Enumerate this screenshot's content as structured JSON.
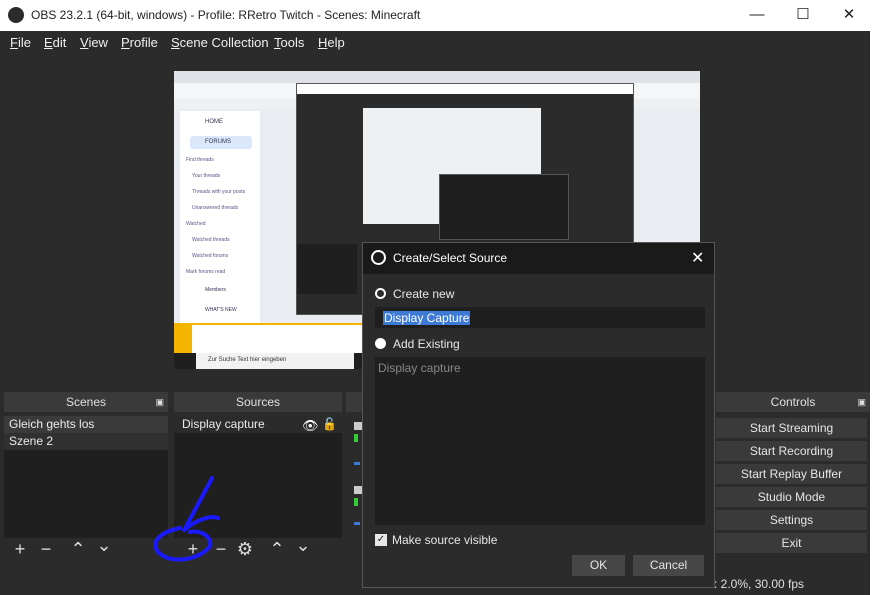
{
  "window": {
    "title": "OBS 23.2.1 (64-bit, windows) - Profile: RRetro Twitch - Scenes: Minecraft",
    "minimize": "—",
    "maximize": "☐",
    "close": "✕"
  },
  "menu": {
    "items": [
      {
        "label": "File",
        "key": "F"
      },
      {
        "label": "Edit",
        "key": "E"
      },
      {
        "label": "View",
        "key": "V"
      },
      {
        "label": "Profile",
        "key": "P"
      },
      {
        "label": "Scene Collection",
        "key": "S"
      },
      {
        "label": "Tools",
        "key": "T"
      },
      {
        "label": "Help",
        "key": "H"
      }
    ]
  },
  "preview": {
    "sidebar": [
      "HOME",
      "FORUMS"
    ],
    "links": [
      "Find threads",
      "Your threads",
      "Threads with your posts",
      "Unanswered threads",
      "Watched",
      "Watched threads",
      "Watched forums",
      "Mark forums read",
      "Members",
      "WHAT'S NEW"
    ],
    "search_hint": "Zur Suche Text hier eingeben"
  },
  "scenes": {
    "title": "Scenes",
    "items": [
      "Gleich gehts los",
      "Szene 2"
    ]
  },
  "sources": {
    "title": "Sources",
    "items": [
      "Display capture"
    ]
  },
  "controls": {
    "title": "Controls",
    "buttons": [
      "Start Streaming",
      "Start Recording",
      "Start Replay Buffer",
      "Studio Mode",
      "Settings",
      "Exit"
    ]
  },
  "status": {
    "text": ": 2.0%, 30.00 fps"
  },
  "dialog": {
    "title": "Create/Select Source",
    "create_new": "Create new",
    "name_value": "Display Capture",
    "add_existing": "Add Existing",
    "existing_items": [
      "Display capture"
    ],
    "make_visible": "Make source visible",
    "ok": "OK",
    "cancel": "Cancel"
  },
  "colors": {
    "dark": "#2b2b2b",
    "panel": "#3a3a3a",
    "list": "#1f1f1f",
    "selection": "#3d7ad6",
    "annotation": "#1a1aff"
  }
}
